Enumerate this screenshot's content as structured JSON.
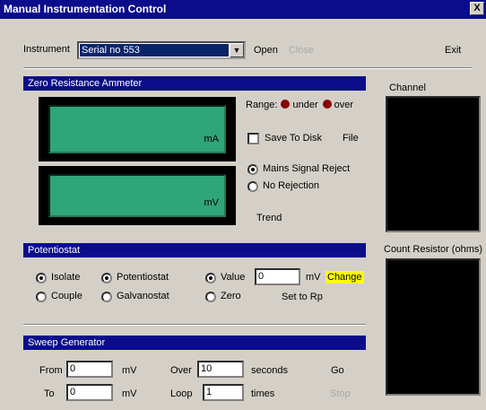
{
  "window": {
    "title": "Manual Instrumentation Control",
    "close_glyph": "X"
  },
  "instrument": {
    "label": "Instrument",
    "selected": "Serial no 553",
    "open_label": "Open",
    "close_label": "Close",
    "exit_label": "Exit"
  },
  "zra": {
    "header": "Zero Resistance Ammeter",
    "unit_ma": "mA",
    "unit_mv": "mV",
    "range_label": "Range:",
    "under_label": "under",
    "over_label": "over",
    "save_label": "Save To Disk",
    "file_label": "File",
    "mains_label": "Mains Signal Reject",
    "norej_label": "No Rejection",
    "trend_label": "Trend",
    "led_color": "#8a0000",
    "meter_color": "#2fa57a"
  },
  "right": {
    "channel_label": "Channel",
    "count_label": "Count Resistor (ohms)"
  },
  "potentiostat": {
    "header": "Potentiostat",
    "isolate": "Isolate",
    "couple": "Couple",
    "potentiostat": "Potentiostat",
    "galvanostat": "Galvanostat",
    "value_label": "Value",
    "value": "0",
    "value_unit": "mV",
    "change_label": "Change",
    "zero_label": "Zero",
    "set_rp": "Set to Rp"
  },
  "sweep": {
    "header": "Sweep Generator",
    "from_label": "From",
    "from_value": "0",
    "from_unit": "mV",
    "to_label": "To",
    "to_value": "0",
    "to_unit": "mV",
    "over_label": "Over",
    "over_value": "10",
    "over_unit": "seconds",
    "loop_label": "Loop",
    "loop_value": "1",
    "loop_unit": "times",
    "go_label": "Go",
    "stop_label": "Stop"
  }
}
